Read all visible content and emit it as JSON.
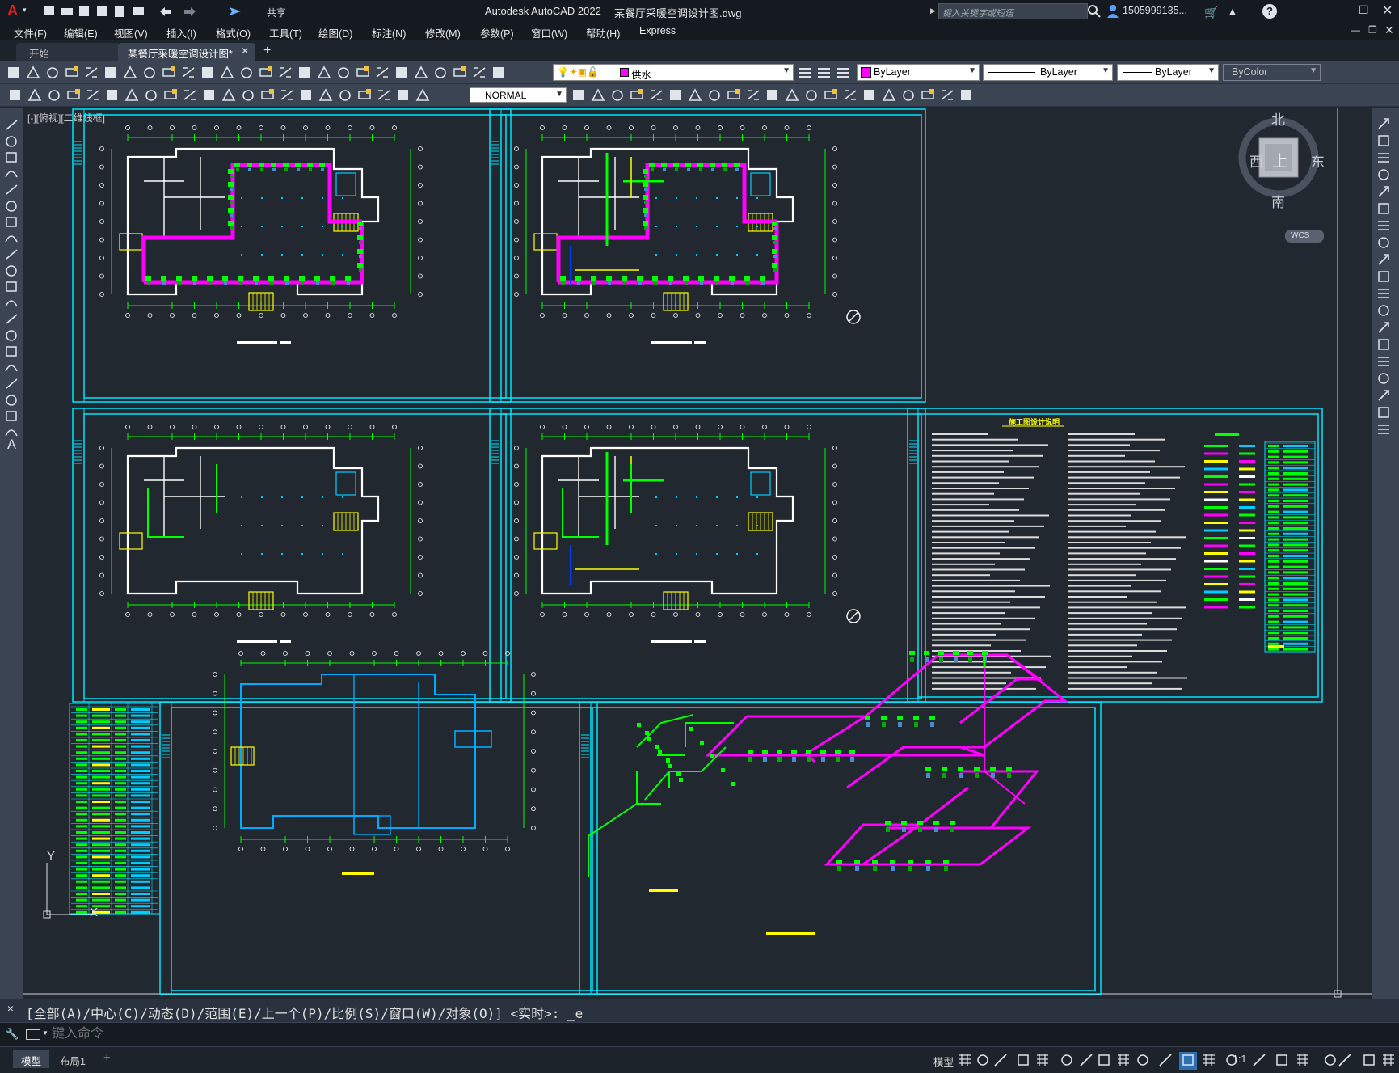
{
  "app": {
    "title": "Autodesk AutoCAD 2022",
    "filename": "某餐厅采暖空调设计图.dwg",
    "logo": "A",
    "share_label": "共享",
    "search_placeholder": "键入关键字或短语",
    "user": "1505999135..."
  },
  "menu": [
    "文件(F)",
    "编辑(E)",
    "视图(V)",
    "插入(I)",
    "格式(O)",
    "工具(T)",
    "绘图(D)",
    "标注(N)",
    "修改(M)",
    "参数(P)",
    "窗口(W)",
    "帮助(H)",
    "Express"
  ],
  "tabs": {
    "start": "开始",
    "active": "某餐厅采暖空调设计图*",
    "new": "+"
  },
  "toolbar": {
    "layer": "供水",
    "color": "ByLayer",
    "linetype": "ByLayer",
    "lineweight": "ByLayer",
    "plotstyle": "ByColor",
    "dimstyle": "NORMAL"
  },
  "viewport": {
    "label": "[-][俯视][二维线框]"
  },
  "viewcube": {
    "north": "北",
    "south": "南",
    "east": "东",
    "west": "西",
    "top": "上",
    "wcs": "WCS"
  },
  "ucs": {
    "x": "X",
    "y": "Y"
  },
  "command": {
    "history": "[全部(A)/中心(C)/动态(D)/范围(E)/上一个(P)/比例(S)/窗口(W)/对象(O)] <实时>: _e",
    "placeholder": "键入命令"
  },
  "status": {
    "model_tab": "模型",
    "layout_tab": "布局1",
    "add": "+",
    "model": "模型",
    "scale": "1:1"
  },
  "colors": {
    "bg": "#212830",
    "frame": "#00e5ff",
    "wall": "#ffffff",
    "green": "#00ff00",
    "magenta": "#ff00ff",
    "yellow": "#ffff00",
    "cyan": "#00ccff",
    "accent": "#e02020"
  }
}
